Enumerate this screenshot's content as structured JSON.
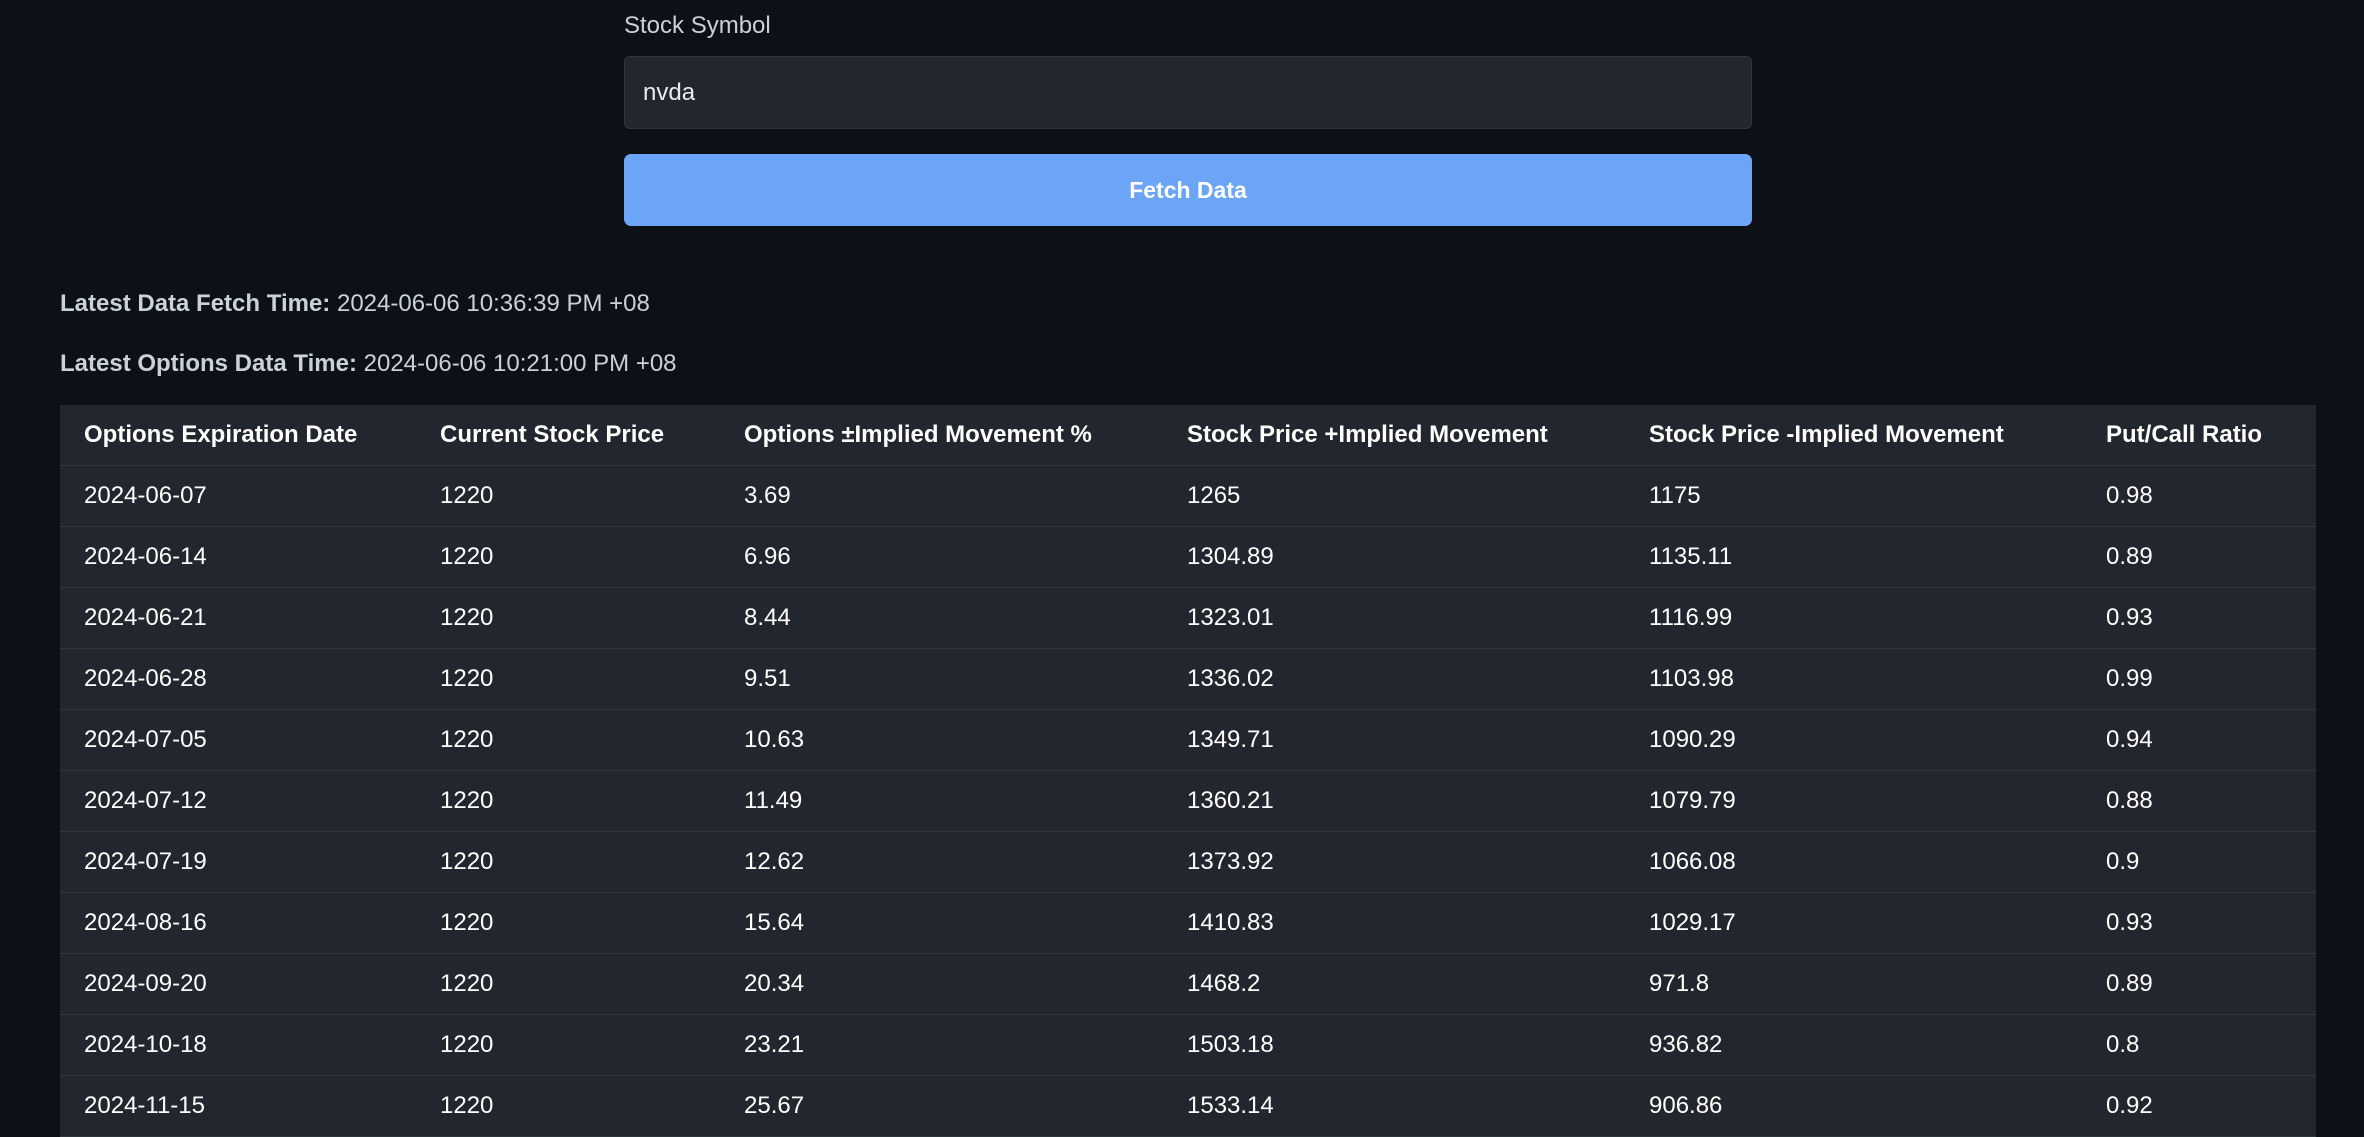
{
  "form": {
    "label": "Stock Symbol",
    "symbol_value": "nvda",
    "fetch_label": "Fetch Data"
  },
  "meta": {
    "fetch_time_label": "Latest Data Fetch Time:",
    "fetch_time_value": "2024-06-06 10:36:39 PM +08",
    "options_time_label": "Latest Options Data Time:",
    "options_time_value": "2024-06-06 10:21:00 PM +08"
  },
  "table": {
    "columns": [
      "Options Expiration Date",
      "Current Stock Price",
      "Options ±Implied Movement %",
      "Stock Price +Implied Movement",
      "Stock Price -Implied Movement",
      "Put/Call Ratio"
    ],
    "rows": [
      [
        "2024-06-07",
        "1220",
        "3.69",
        "1265",
        "1175",
        "0.98"
      ],
      [
        "2024-06-14",
        "1220",
        "6.96",
        "1304.89",
        "1135.11",
        "0.89"
      ],
      [
        "2024-06-21",
        "1220",
        "8.44",
        "1323.01",
        "1116.99",
        "0.93"
      ],
      [
        "2024-06-28",
        "1220",
        "9.51",
        "1336.02",
        "1103.98",
        "0.99"
      ],
      [
        "2024-07-05",
        "1220",
        "10.63",
        "1349.71",
        "1090.29",
        "0.94"
      ],
      [
        "2024-07-12",
        "1220",
        "11.49",
        "1360.21",
        "1079.79",
        "0.88"
      ],
      [
        "2024-07-19",
        "1220",
        "12.62",
        "1373.92",
        "1066.08",
        "0.9"
      ],
      [
        "2024-08-16",
        "1220",
        "15.64",
        "1410.83",
        "1029.17",
        "0.93"
      ],
      [
        "2024-09-20",
        "1220",
        "20.34",
        "1468.2",
        "971.8",
        "0.89"
      ],
      [
        "2024-10-18",
        "1220",
        "23.21",
        "1503.18",
        "936.82",
        "0.8"
      ],
      [
        "2024-11-15",
        "1220",
        "25.67",
        "1533.14",
        "906.86",
        "0.92"
      ]
    ]
  },
  "colors": {
    "background": "#0d1117",
    "panel": "#22262e",
    "accent": "#6ca5f8"
  }
}
